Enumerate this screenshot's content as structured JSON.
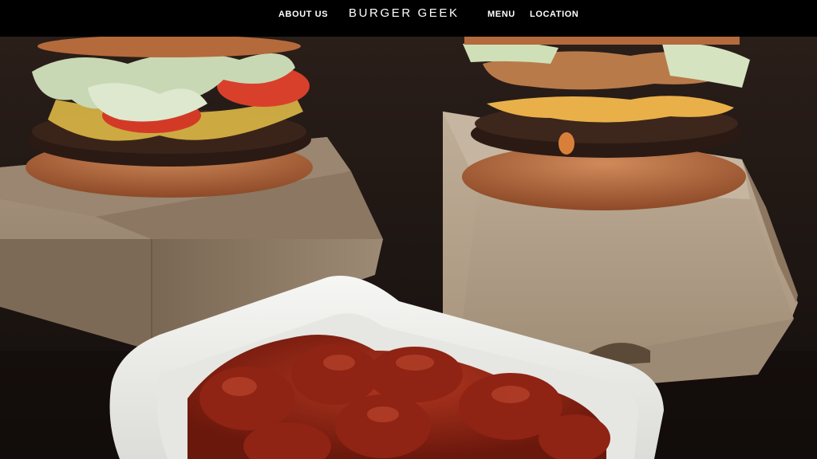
{
  "nav": {
    "about_label": "ABOUT US",
    "brand": "BURGER GEEK",
    "menu_label": "MENU",
    "location_label": "LOCATION"
  },
  "hero": {
    "image_subject": "two burgers on kraft boxes with a tray of buffalo wings",
    "colors": {
      "background": "#1a1412",
      "box_kraft": "#b9a48c",
      "bun": "#b0643a",
      "wings_sauce": "#8e2214",
      "tray": "#f1f1ef"
    }
  }
}
